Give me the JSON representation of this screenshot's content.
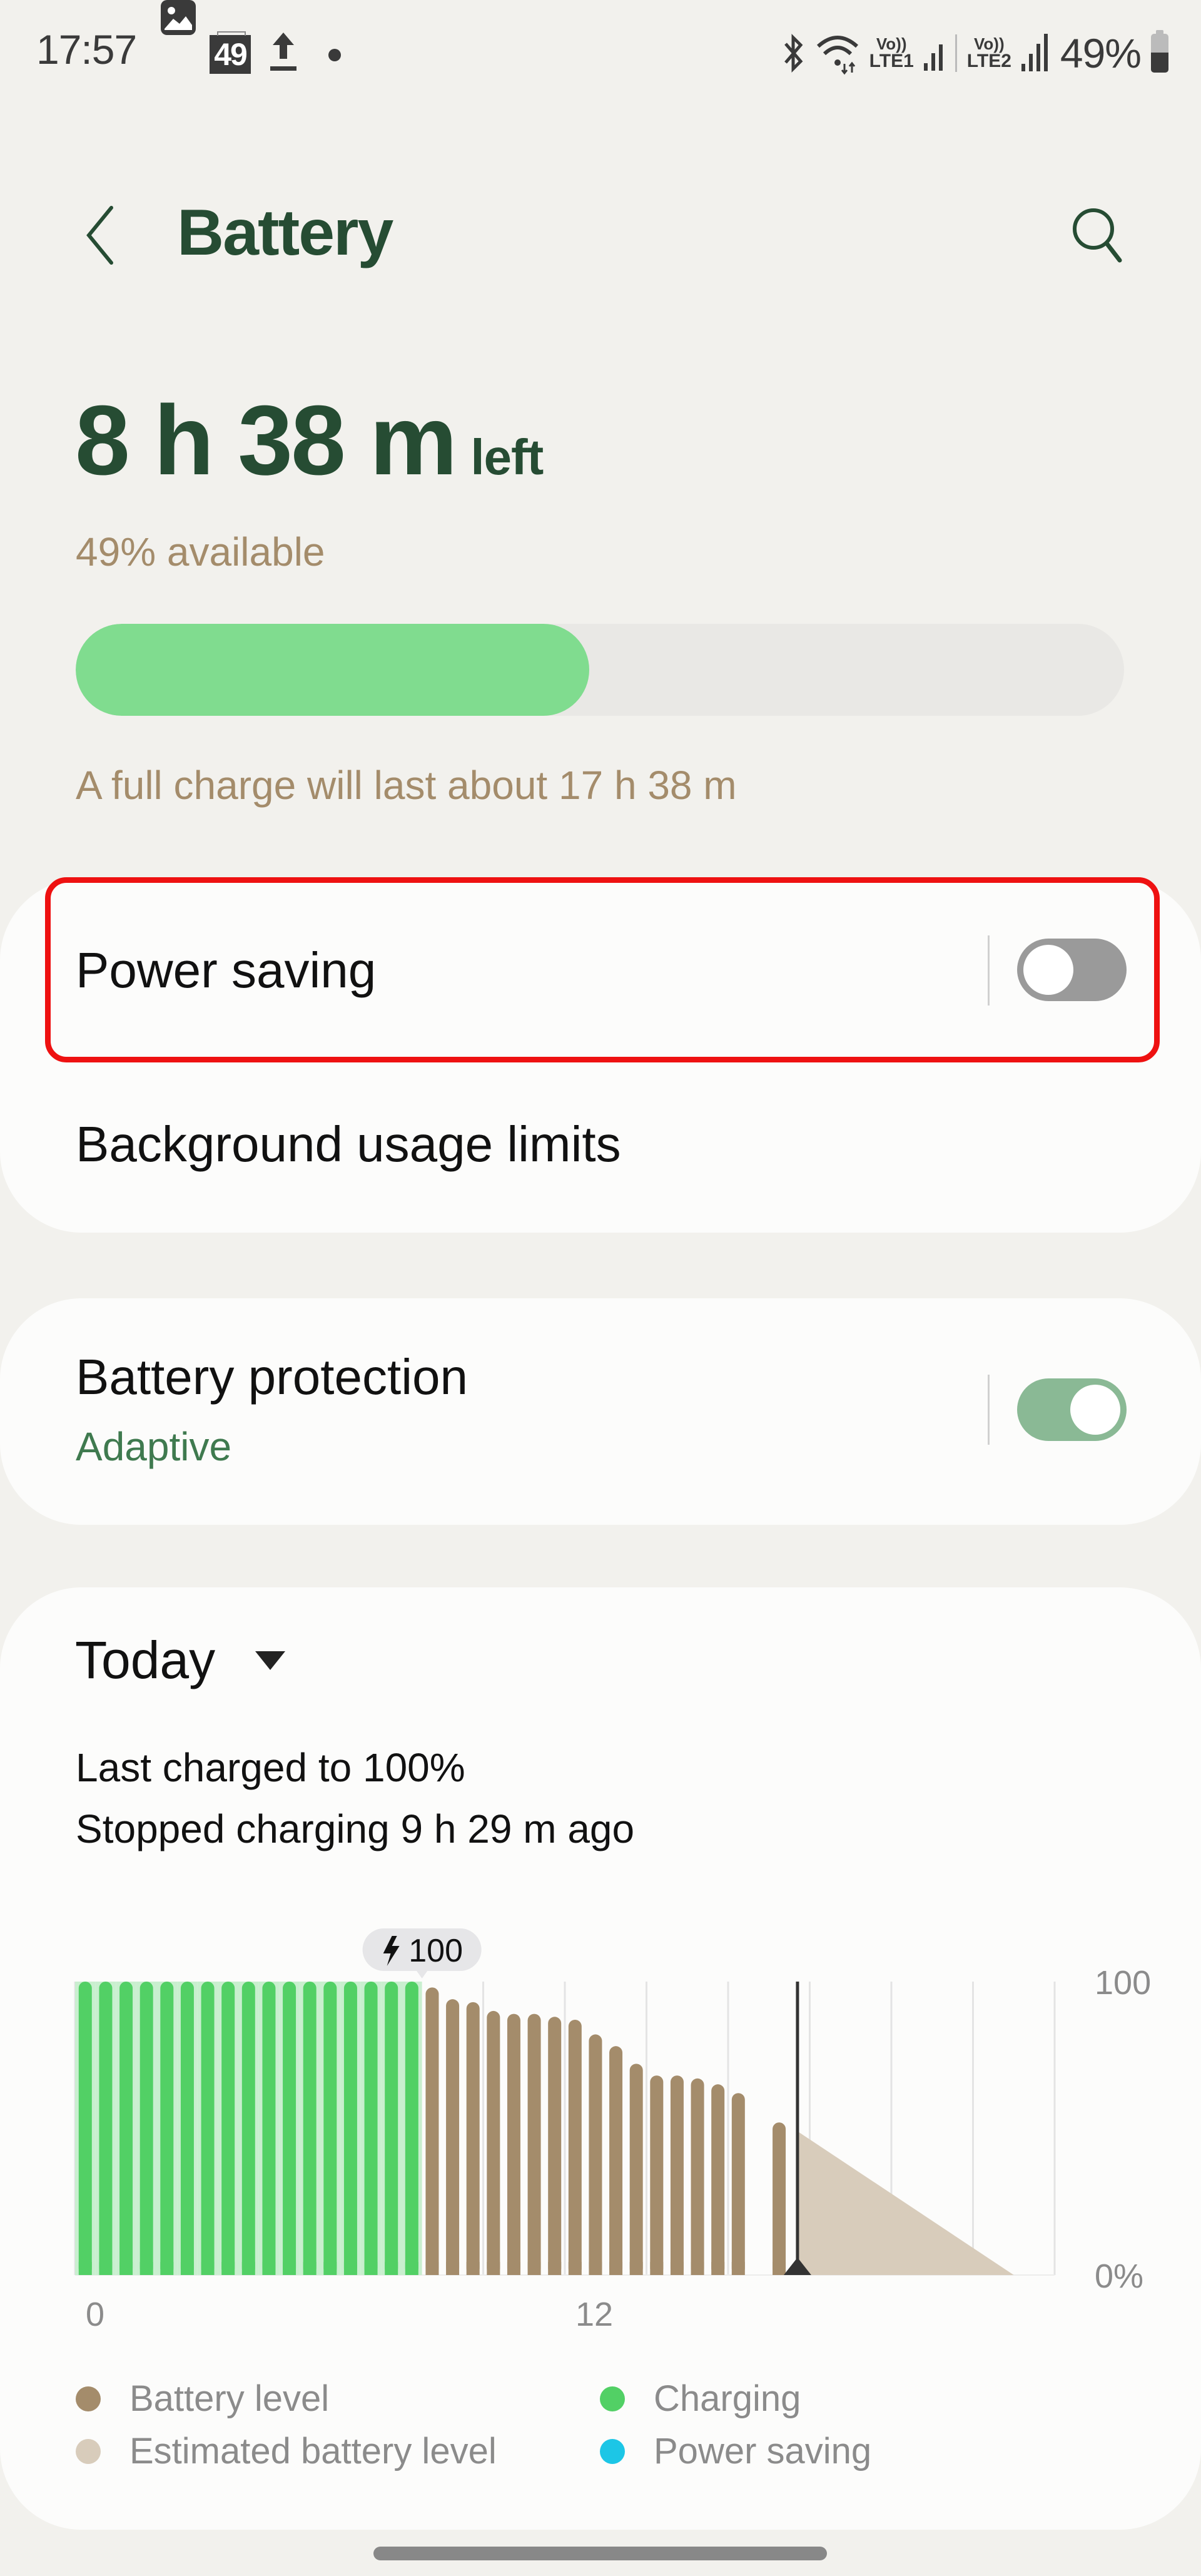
{
  "status_bar": {
    "time": "17:57",
    "left_icons": [
      "gallery-icon",
      "calendar-49-icon",
      "upload-icon",
      "dot-icon"
    ],
    "calendar_badge": "49",
    "right_icons": [
      "bluetooth-icon",
      "wifi-icon",
      "volte-lte1-icon",
      "signal-1-icon",
      "volte-lte2-icon",
      "signal-2-icon",
      "battery-icon"
    ],
    "lte1_label": [
      "Vo))",
      "LTE1"
    ],
    "lte2_label": [
      "Vo))",
      "LTE2"
    ],
    "battery_percent": "49%"
  },
  "header": {
    "title": "Battery",
    "back_icon": "chevron-left-icon",
    "search_icon": "search-icon"
  },
  "summary": {
    "time_left": "8 h 38 m",
    "time_left_suffix": "left",
    "available": "49% available",
    "level_fraction": 0.49,
    "full_charge": "A full charge will last about 17 h 38 m"
  },
  "settings": {
    "power_saving": {
      "label": "Power saving",
      "enabled": false
    },
    "background_limits": {
      "label": "Background usage limits"
    },
    "battery_protection": {
      "label": "Battery protection",
      "value": "Adaptive",
      "enabled": true
    }
  },
  "usage": {
    "period": "Today",
    "last_charged": "Last charged to 100%",
    "stopped_charging": "Stopped charging 9 h 29 m ago"
  },
  "colors": {
    "accent_green": "#264c33",
    "secondary_text": "#a48c6b",
    "progress_fill": "#80dc8f",
    "charging": "#52d065",
    "charging_bg": "#c9efcf",
    "battery_level": "#a48c6b",
    "estimated": "#d8ccbb",
    "power_saving": "#1cc6e6",
    "highlight": "#ee1111"
  },
  "chart_data": {
    "type": "bar",
    "title": "",
    "xlabel": "",
    "ylabel": "",
    "x_unit": "hour of day",
    "x_range": [
      0,
      24
    ],
    "slot_minutes": 30,
    "ylim": [
      0,
      100
    ],
    "x_tick_labels": [
      {
        "x": 0,
        "label": "0"
      },
      {
        "x": 12,
        "label": "12"
      }
    ],
    "y_tick_labels": [
      {
        "y": 100,
        "label": "100"
      },
      {
        "y": 0,
        "label": "0%"
      }
    ],
    "gridlines_every_hours": 2,
    "grid": true,
    "series": [
      {
        "name": "Charging",
        "start_slot": 0,
        "values": [
          100,
          100,
          100,
          100,
          100,
          100,
          100,
          100,
          100,
          100,
          100,
          100,
          100,
          100,
          100,
          100,
          100
        ]
      },
      {
        "name": "Battery level",
        "start_slot": 17,
        "values": [
          98,
          94,
          93,
          90,
          89,
          89,
          88,
          87,
          82,
          78,
          72,
          68,
          68,
          67,
          65,
          62,
          null,
          52
        ]
      },
      {
        "name": "Estimated battery level",
        "type": "area",
        "points": [
          [
            17.7,
            49
          ],
          [
            23.0,
            0
          ]
        ]
      }
    ],
    "current_time_hour": 17.7,
    "annotation": {
      "label": "100",
      "icon": "lightning-icon",
      "at_slot": 16
    },
    "legend": [
      {
        "label": "Battery level",
        "color": "#a48c6b"
      },
      {
        "label": "Charging",
        "color": "#52d065"
      },
      {
        "label": "Estimated battery level",
        "color": "#d8ccbb"
      },
      {
        "label": "Power saving",
        "color": "#1cc6e6"
      }
    ],
    "legend_position": "bottom"
  }
}
